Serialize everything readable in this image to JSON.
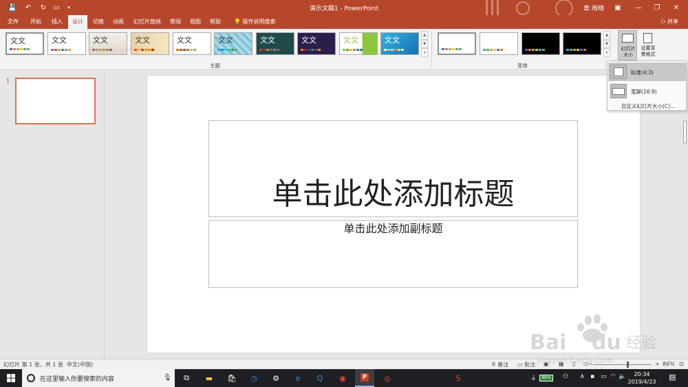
{
  "titlebar": {
    "doc_title": "演示文稿1 - PowerPoint",
    "user_name": "章 雨晴"
  },
  "tabs": [
    {
      "label": "文件"
    },
    {
      "label": "开始"
    },
    {
      "label": "插入"
    },
    {
      "label": "设计"
    },
    {
      "label": "切换"
    },
    {
      "label": "动画"
    },
    {
      "label": "幻灯片放映"
    },
    {
      "label": "审阅"
    },
    {
      "label": "视图"
    },
    {
      "label": "帮助"
    },
    {
      "label": "操作说明搜索"
    }
  ],
  "share_label": "共享",
  "ribbon": {
    "theme_thumb_text": "文文",
    "theme_variant_text": "文文",
    "themes_group_label": "主题",
    "variants_group_label": "变体",
    "slide_size_label": "幻灯片\n大小",
    "bg_format_label": "设置背\n景格式"
  },
  "dropdown": {
    "items": [
      {
        "label": "标准(4:3)"
      },
      {
        "label": "宽屏(16:9)"
      }
    ],
    "custom": "自定义幻灯片大小(C)..."
  },
  "thumbnails": {
    "number": "1"
  },
  "slide": {
    "title_placeholder": "单击此处添加标题",
    "subtitle_placeholder": "单击此处添加副标题"
  },
  "statusbar": {
    "slide_info": "幻灯片 第 1 张，共 1 张",
    "language": "中文(中国)",
    "notes": "备注",
    "comments": "批注",
    "zoom": "86%"
  },
  "taskbar": {
    "search_placeholder": "在这里输入你要搜索的内容",
    "battery": "86%",
    "time": "20:34",
    "date": "2019/4/23"
  },
  "colors": {
    "accent": "#b7472a",
    "ribbon_bg": "#f3f3f3"
  }
}
